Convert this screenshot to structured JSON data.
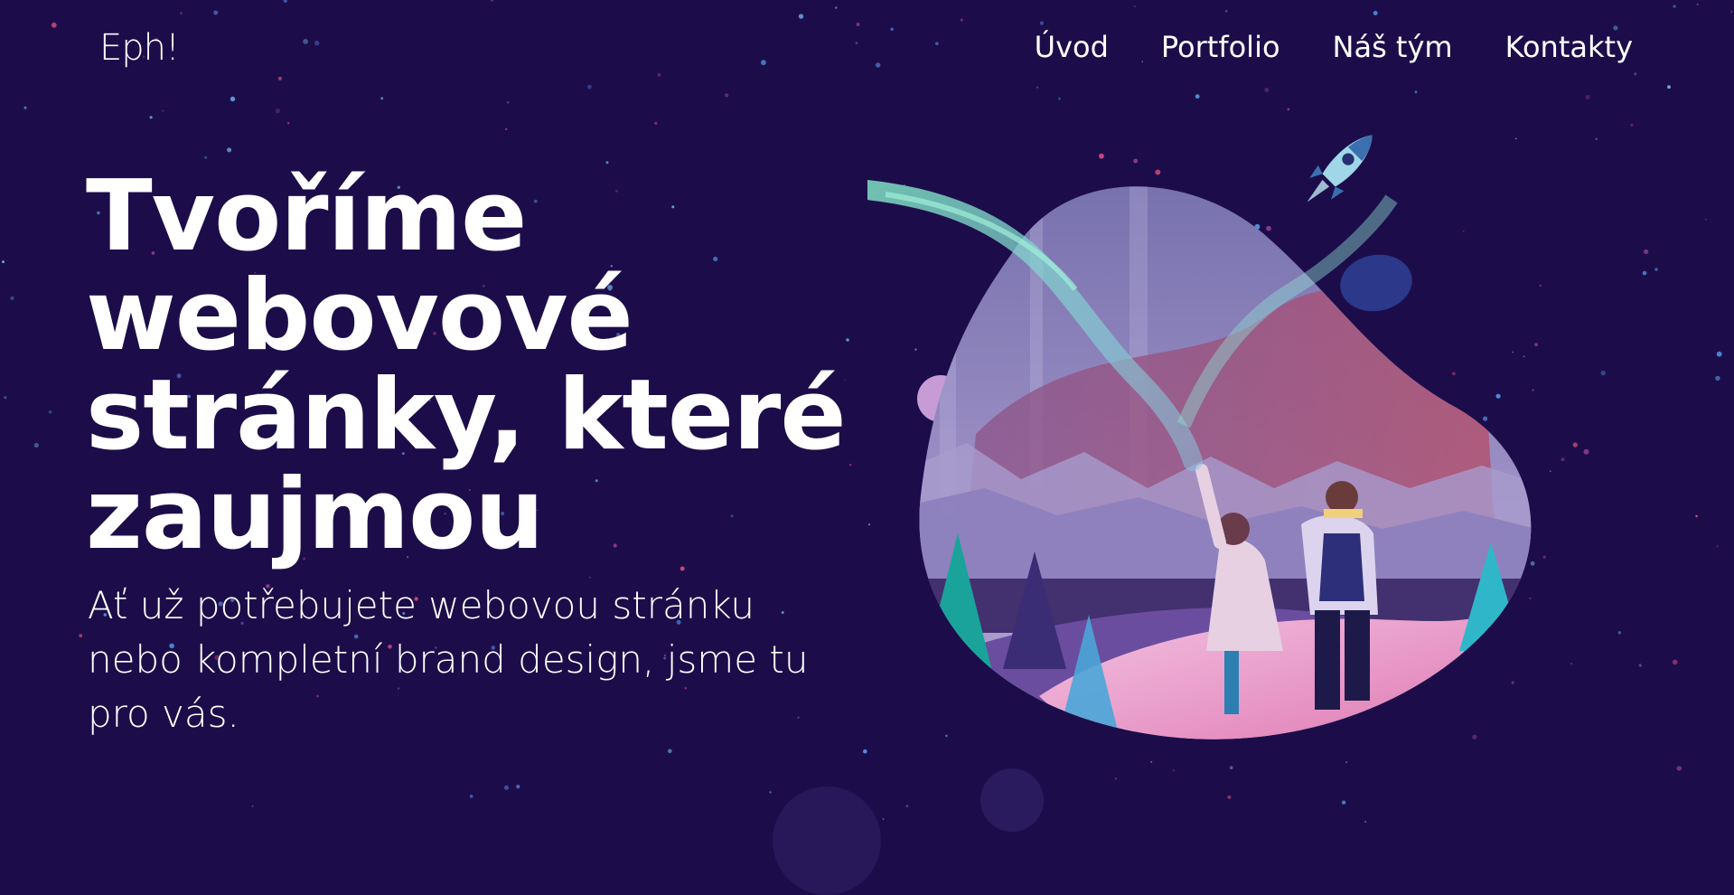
{
  "header": {
    "logo": "Eph!",
    "nav": [
      {
        "label": "Úvod"
      },
      {
        "label": "Portfolio"
      },
      {
        "label": "Náš tým"
      },
      {
        "label": "Kontakty"
      }
    ]
  },
  "hero": {
    "title_lines": [
      "Tvoříme",
      "webovové",
      "stránky, které",
      "zaujmou"
    ],
    "subtitle_lines": [
      "Ať už potřebujete webovou stránku",
      "nebo kompletní brand design, jsme tu",
      "pro vás."
    ]
  },
  "colors": {
    "background": "#1c0d4a",
    "text": "#ffffff",
    "aurora": "#7fe0c4",
    "blob_pink": "#e27fb4",
    "blob_purple": "#8b7bc0"
  },
  "icons": {
    "rocket": "rocket-icon",
    "illustration": "people-watching-aurora-illustration"
  }
}
